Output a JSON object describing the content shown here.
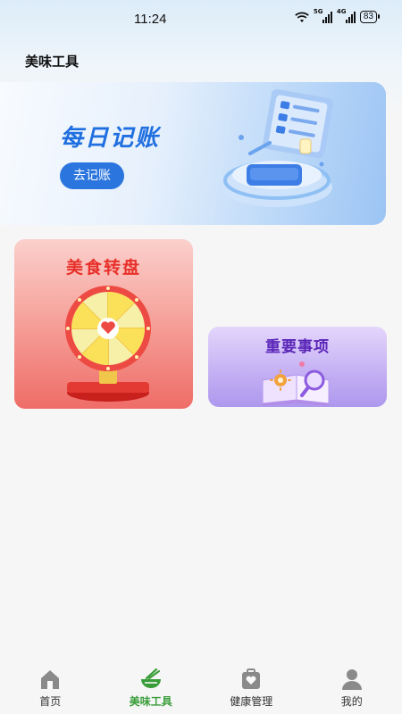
{
  "status_bar": {
    "time": "11:24",
    "signal_1_label": "5G",
    "signal_2_label": "4G",
    "battery": "83"
  },
  "page": {
    "title": "美味工具"
  },
  "ledger_card": {
    "title": "每日记账",
    "button_label": "去记账"
  },
  "wheel_card": {
    "title": "美食转盘"
  },
  "todo_card": {
    "title": "重要事项"
  },
  "tab_bar": {
    "active_color": "#3a9d3a",
    "items": [
      {
        "label": "首页",
        "icon": "home-icon"
      },
      {
        "label": "美味工具",
        "icon": "bowl-icon"
      },
      {
        "label": "健康管理",
        "icon": "heart-bag-icon"
      },
      {
        "label": "我的",
        "icon": "person-icon"
      }
    ]
  }
}
